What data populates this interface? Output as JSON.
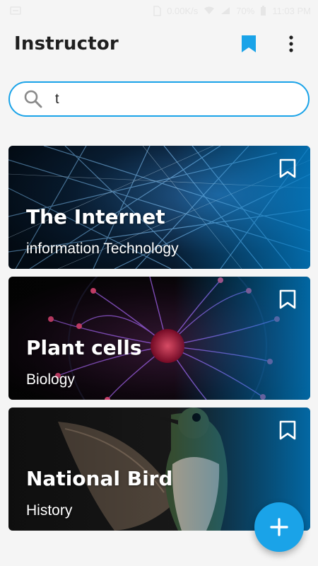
{
  "status_bar": {
    "net_speed": "0.00K/s",
    "battery": "70%",
    "time": "11:03 PM"
  },
  "app_bar": {
    "title": "Instructor",
    "bookmark_icon": "bookmark-icon",
    "menu_icon": "more-vert-icon"
  },
  "search": {
    "value": "t",
    "icon": "search-icon"
  },
  "colors": {
    "accent": "#1aa3e8",
    "background": "#f5f5f5"
  },
  "cards": [
    {
      "title": "The Internet",
      "subtitle": "information Technology",
      "image": "network-lines"
    },
    {
      "title": "Plant cells",
      "subtitle": "Biology",
      "image": "plasma-ball"
    },
    {
      "title": "National Bird",
      "subtitle": "History",
      "image": "hummingbird"
    }
  ],
  "fab": {
    "icon": "plus-icon"
  }
}
